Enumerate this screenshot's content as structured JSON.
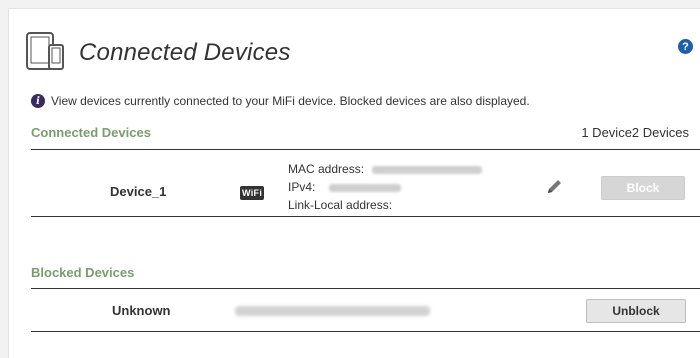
{
  "page": {
    "title": "Connected Devices",
    "help_icon": "?",
    "info_text": "View devices currently connected to your MiFi device. Blocked devices are also displayed.",
    "connected": {
      "section_title": "Connected Devices",
      "count_text": "1 Device2 Devices",
      "device": {
        "name": "Device_1",
        "badge": "WiFi",
        "mac_label": "MAC address:",
        "ipv4_label": "IPv4:",
        "linklocal_label": "Link-Local address:",
        "block_label": "Block"
      }
    },
    "blocked": {
      "section_title": "Blocked Devices",
      "device": {
        "name": "Unknown",
        "unblock_label": "Unblock"
      }
    }
  },
  "colors": {
    "section_title": "#7a9d6e",
    "help_icon": "#1f5fa8",
    "info_icon": "#3b2a60"
  }
}
